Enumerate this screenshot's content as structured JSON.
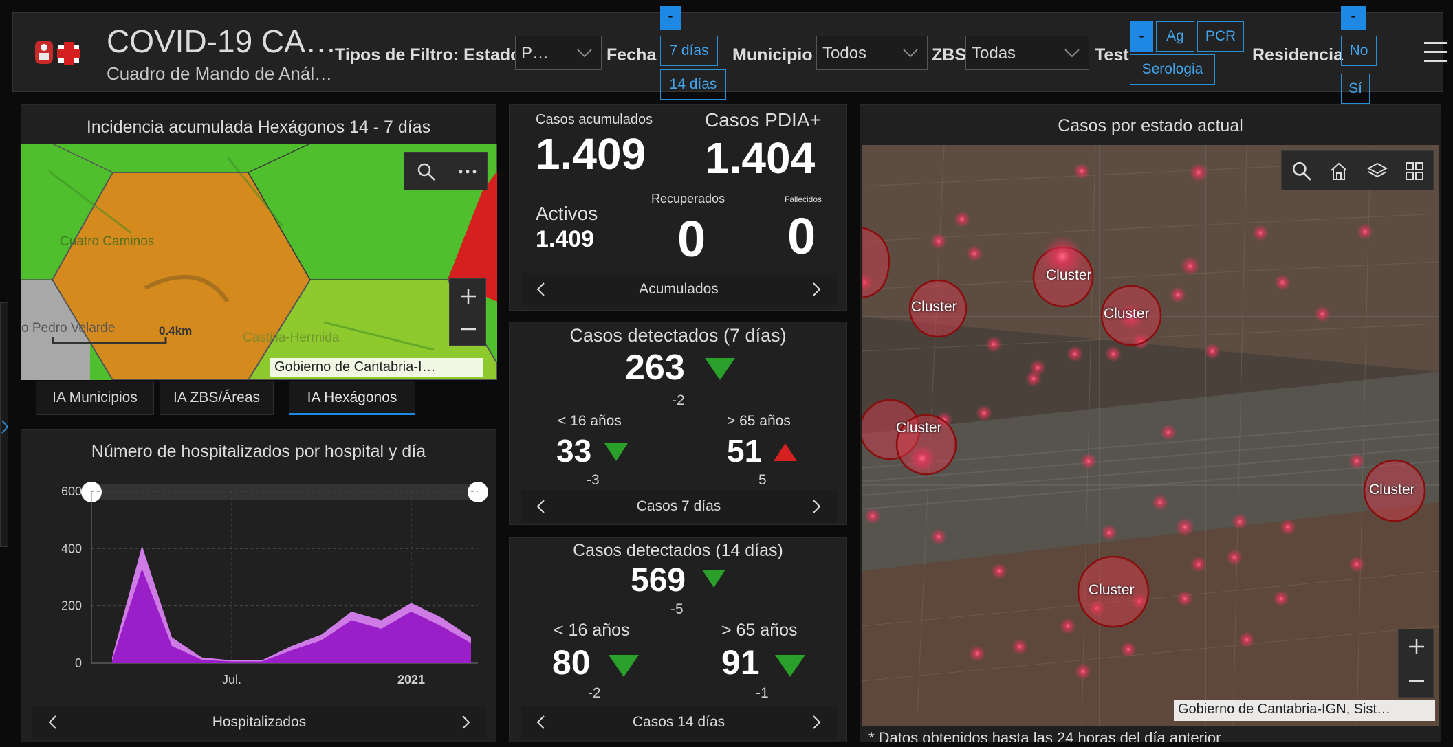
{
  "header": {
    "title": "COVID-19 CA…",
    "subtitle": "Cuadro de Mando de Anál…",
    "filter_label": "Tipos de Filtro: Estado",
    "estado_value": "P…",
    "fecha_label": "Fecha",
    "fecha_options": [
      "-",
      "7 días",
      "14 días"
    ],
    "municipio_label": "Municipio",
    "municipio_value": "Todos",
    "zbs_label": "ZBS",
    "zbs_value": "Todas",
    "test_label": "Test",
    "test_options": [
      "-",
      "Ag",
      "PCR",
      "Serologia"
    ],
    "residencia_label": "Residencia",
    "residencia_options": [
      "-",
      "No",
      "Sí"
    ],
    "menu_icon": "hamburger-icon"
  },
  "hex_map": {
    "title": "Incidencia acumulada Hexágonos 14 - 7 días",
    "place_labels": [
      "Cuatro Caminos",
      "o Pedro Velarde",
      "Castilla-Hermida"
    ],
    "scale_label": "0.4km",
    "attribution": "Gobierno de Cantabria-I…",
    "tabs": [
      "IA Municipios",
      "IA ZBS/Áreas",
      "IA Hexágonos"
    ],
    "active_tab": "IA Hexágonos",
    "colors": {
      "green": "#4fbf2e",
      "orange": "#d48a1c",
      "yellow_green": "#8ec92e",
      "gray": "#a8a8a8",
      "red": "#d61f1f"
    }
  },
  "hospital_chart": {
    "title": "Número de hospitalizados por hospital y día",
    "nav_label": "Hospitalizados"
  },
  "chart_data": {
    "type": "area",
    "title": "Número de hospitalizados por hospital y día",
    "xlabel": "",
    "ylabel": "",
    "ylim": [
      0,
      600
    ],
    "yticks": [
      0,
      200,
      400,
      600
    ],
    "xtick_labels": [
      "Jul.",
      "2021"
    ],
    "x": [
      "2020-03",
      "2020-04",
      "2020-05",
      "2020-06",
      "2020-07",
      "2020-08",
      "2020-09",
      "2020-10",
      "2020-11",
      "2020-12",
      "2021-01",
      "2021-02",
      "2021-03"
    ],
    "series": [
      {
        "values": [
          20,
          410,
          90,
          20,
          10,
          10,
          60,
          100,
          180,
          150,
          210,
          160,
          90
        ]
      },
      {
        "values": [
          10,
          330,
          60,
          12,
          6,
          6,
          45,
          80,
          150,
          120,
          180,
          130,
          70
        ]
      }
    ],
    "colors": [
      "#cf7be6",
      "#9a1fc9"
    ]
  },
  "stats_acumulados": {
    "casos_acumulados_label": "Casos acumulados",
    "casos_acumulados": "1.409",
    "casos_pdia_label": "Casos PDIA+",
    "casos_pdia": "1.404",
    "activos_label": "Activos",
    "activos": "1.409",
    "recuperados_label": "Recuperados",
    "recuperados": "0",
    "fallecidos_label": "Fallecidos",
    "fallecidos": "0",
    "nav_label": "Acumulados"
  },
  "stats_7": {
    "title": "Casos detectados (7 días)",
    "value": "263",
    "delta": "-2",
    "under16_label": "< 16 años",
    "under16": "33",
    "under16_delta": "-3",
    "over65_label": "> 65 años",
    "over65": "51",
    "over65_delta": "5",
    "nav_label": "Casos 7 días"
  },
  "stats_14": {
    "title": "Casos detectados (14 días)",
    "value": "569",
    "delta": "-5",
    "under16_label": "< 16 años",
    "under16": "80",
    "under16_delta": "-2",
    "over65_label": "> 65 años",
    "over65": "91",
    "over65_delta": "-1",
    "nav_label": "Casos 14 días"
  },
  "cluster_map": {
    "title": "Casos por estado actual",
    "cluster_label": "Cluster",
    "attribution": "Gobierno de Cantabria-IGN, Sist…",
    "footer_note": "* Datos obtenidos hasta las 24 horas del día anterior"
  }
}
